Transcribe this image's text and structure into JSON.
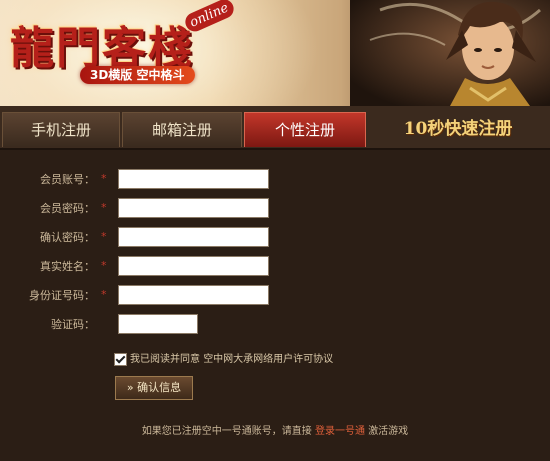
{
  "header": {
    "logo_text": "龍門客棧",
    "logo_badge": "online",
    "logo_sub": "3D横版 空中格斗"
  },
  "tabs": [
    {
      "label": "手机注册"
    },
    {
      "label": "邮箱注册"
    },
    {
      "label": "个性注册",
      "active": true
    },
    {
      "label": "10秒快速注册"
    }
  ],
  "form": {
    "required_mark": "*",
    "fields": [
      {
        "label": "会员账号：",
        "value": ""
      },
      {
        "label": "会员密码：",
        "value": ""
      },
      {
        "label": "确认密码：",
        "value": ""
      },
      {
        "label": "真实姓名：",
        "value": ""
      },
      {
        "label": "身份证号码：",
        "value": ""
      },
      {
        "label": "验证码：",
        "value": ""
      }
    ],
    "agreement": {
      "checked": true,
      "text": "我已阅读并同意",
      "link_text": "空中网大承网络用户许可协议"
    },
    "submit_label": "» 确认信息"
  },
  "footer": {
    "prefix": "如果您已注册空中一号通账号，请直接",
    "link_text": "登录一号通",
    "suffix": "激活游戏"
  },
  "colors": {
    "background": "#2b1e15",
    "active_tab": "#c2372a",
    "accent_link": "#e0603a"
  }
}
